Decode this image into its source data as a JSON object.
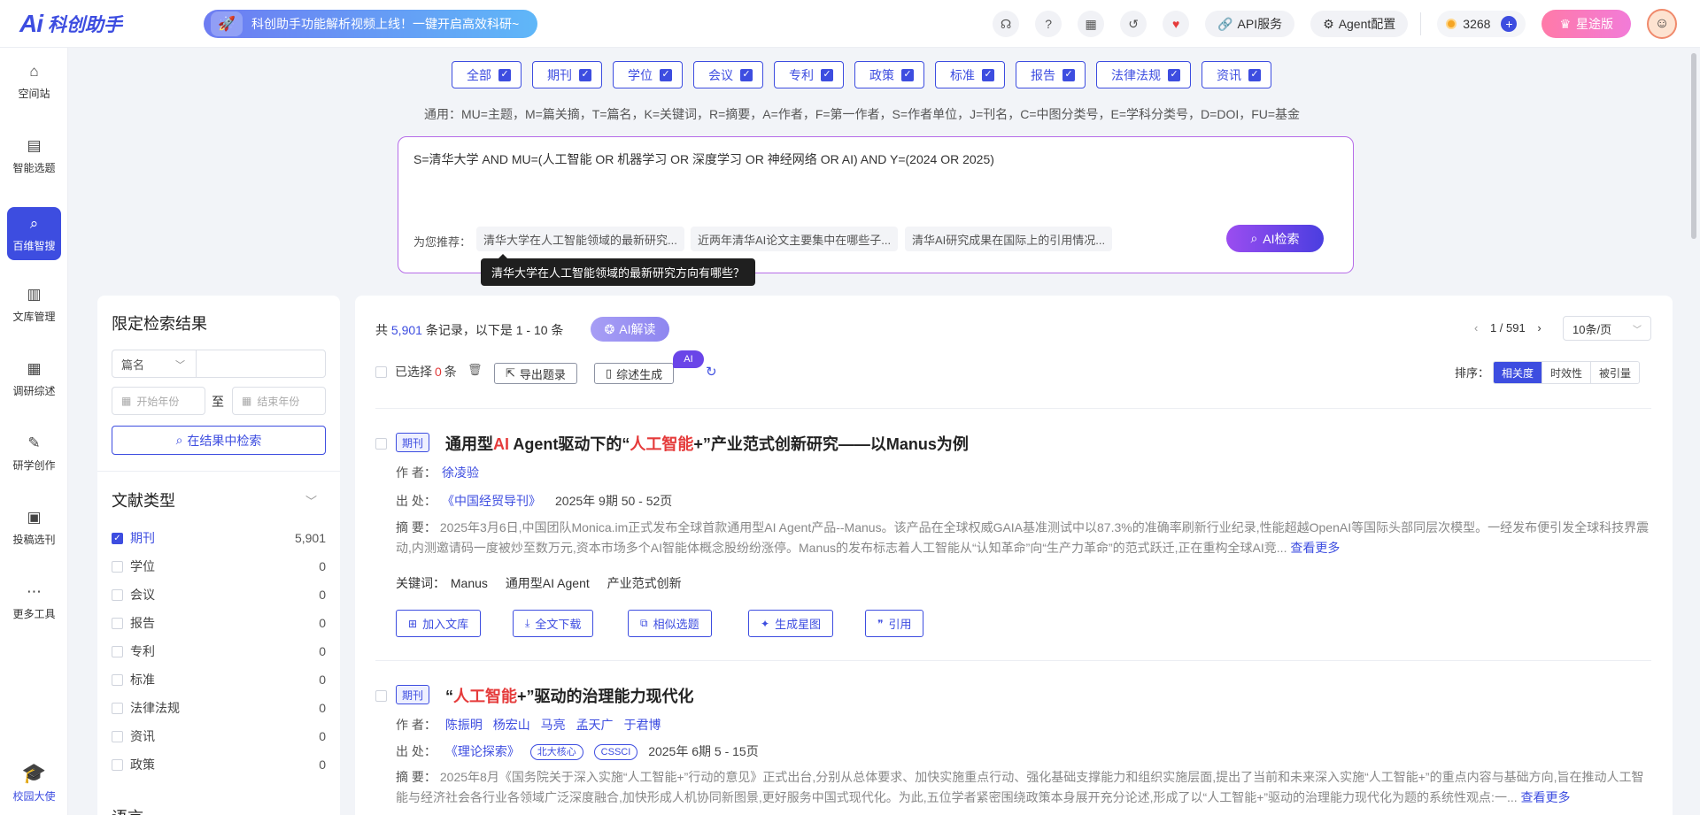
{
  "topbar": {
    "logo_text": "科创助手",
    "promo": "科创助手功能解析视频上线！一键开启高效科研~",
    "api_service": "API服务",
    "agent_config": "Agent配置",
    "coins": "3268",
    "vip": "星途版"
  },
  "sidebar": {
    "items": [
      {
        "label": "空间站",
        "icon": "home-icon"
      },
      {
        "label": "智能选题",
        "icon": "clipboard-icon"
      },
      {
        "label": "百维智搜",
        "icon": "search-doc-icon"
      },
      {
        "label": "文库管理",
        "icon": "library-icon"
      },
      {
        "label": "调研综述",
        "icon": "book-icon"
      },
      {
        "label": "研学创作",
        "icon": "edit-icon"
      },
      {
        "label": "投稿选刊",
        "icon": "submit-icon"
      },
      {
        "label": "更多工具",
        "icon": "more-icon"
      }
    ],
    "campus": "校园大使",
    "active_index": 2
  },
  "filters": [
    "全部",
    "期刊",
    "学位",
    "会议",
    "专利",
    "政策",
    "标准",
    "报告",
    "法律法规",
    "资讯"
  ],
  "legend": "通用：MU=主题，M=篇关摘，T=篇名，K=关键词，R=摘要，A=作者，F=第一作者，S=作者单位，J=刊名，C=中图分类号，E=学科分类号，D=DOI，FU=基金",
  "search": {
    "query": "S=清华大学 AND MU=(人工智能 OR 机器学习 OR 深度学习 OR 神经网络 OR AI) AND Y=(2024 OR 2025)",
    "rec_label": "为您推荐：",
    "recommendations": [
      "清华大学在人工智能领域的最新研究...",
      "近两年清华AI论文主要集中在哪些子...",
      "清华AI研究成果在国际上的引用情况..."
    ],
    "button": "AI检索",
    "tooltip": "清华大学在人工智能领域的最新研究方向有哪些？"
  },
  "left_panel": {
    "title": "限定检索结果",
    "field_select": "篇名",
    "start_year": "开始年份",
    "to": "至",
    "end_year": "结束年份",
    "search_in_results": "在结果中检索",
    "doc_type_title": "文献类型",
    "doc_types": [
      {
        "label": "期刊",
        "count": "5,901",
        "checked": true
      },
      {
        "label": "学位",
        "count": "0",
        "checked": false
      },
      {
        "label": "会议",
        "count": "0",
        "checked": false
      },
      {
        "label": "报告",
        "count": "0",
        "checked": false
      },
      {
        "label": "专利",
        "count": "0",
        "checked": false
      },
      {
        "label": "标准",
        "count": "0",
        "checked": false
      },
      {
        "label": "法律法规",
        "count": "0",
        "checked": false
      },
      {
        "label": "资讯",
        "count": "0",
        "checked": false
      },
      {
        "label": "政策",
        "count": "0",
        "checked": false
      }
    ],
    "next_section": "语言"
  },
  "results": {
    "summary_prefix": "共",
    "total": "5,901",
    "summary_suffix": "条记录，以下是 1 - 10 条",
    "ai_read": "AI解读",
    "page": "1 / 591",
    "per_page": "10条/页",
    "selected_prefix": "已选择",
    "selected_count": "0",
    "selected_suffix": "条",
    "export": "导出题录",
    "summarize": "综述生成",
    "ai_badge": "AI",
    "sort_label": "排序：",
    "sort_options": [
      "相关度",
      "时效性",
      "被引量"
    ],
    "labels": {
      "author": "作    者：",
      "source": "出    处：",
      "abstract": "摘    要：",
      "keywords": "关键词："
    },
    "items": [
      {
        "type": "期刊",
        "title_parts": [
          {
            "t": "通用型",
            "h": false
          },
          {
            "t": "AI",
            "h": true
          },
          {
            "t": " Agent驱动下的“",
            "h": false
          },
          {
            "t": "人工智能",
            "h": true
          },
          {
            "t": "+”产业范式创新研究——以Manus为例",
            "h": false
          }
        ],
        "authors": [
          "徐凌验"
        ],
        "journal": "《中国经贸导刊》",
        "badges": [],
        "issue": "2025年 9期 50 - 52页",
        "abstract": "2025年3月6日,中国团队Monica.im正式发布全球首款通用型AI Agent产品--Manus。该产品在全球权威GAIA基准测试中以87.3%的准确率刷新行业纪录,性能超越OpenAI等国际头部同层次模型。一经发布便引发全球科技界震动,内测邀请码一度被炒至数万元,资本市场多个AI智能体概念股纷纷涨停。Manus的发布标志着人工智能从“认知革命”向“生产力革命”的范式跃迁,正在重构全球AI竞...",
        "more": "查看更多",
        "keywords": [
          "Manus",
          "通用型AI Agent",
          "产业范式创新"
        ],
        "actions": [
          "加入文库",
          "全文下载",
          "相似选题",
          "生成星图",
          "引用"
        ]
      },
      {
        "type": "期刊",
        "title_parts": [
          {
            "t": "“",
            "h": false
          },
          {
            "t": "人工智能",
            "h": true
          },
          {
            "t": "+”驱动的治理能力现代化",
            "h": false
          }
        ],
        "authors": [
          "陈振明",
          "杨宏山",
          "马亮",
          "孟天广",
          "于君博"
        ],
        "journal": "《理论探索》",
        "badges": [
          "北大核心",
          "CSSCI"
        ],
        "issue": "2025年 6期 5 - 15页",
        "abstract": "2025年8月《国务院关于深入实施“人工智能+”行动的意见》正式出台,分别从总体要求、加快实施重点行动、强化基础支撑能力和组织实施层面,提出了当前和未来深入实施“人工智能+”的重点内容与基础方向,旨在推动人工智能与经济社会各行业各领域广泛深度融合,加快形成人机协同新图景,更好服务中国式现代化。为此,五位学者紧密围绕政策本身展开充分论述,形成了以“人工智能+”驱动的治理能力现代化为题的系统性观点:一...",
        "more": "查看更多"
      }
    ]
  },
  "colors": {
    "primary": "#3d4de0",
    "highlight": "#e53b3b",
    "ai_purple": "#9b4df0"
  }
}
